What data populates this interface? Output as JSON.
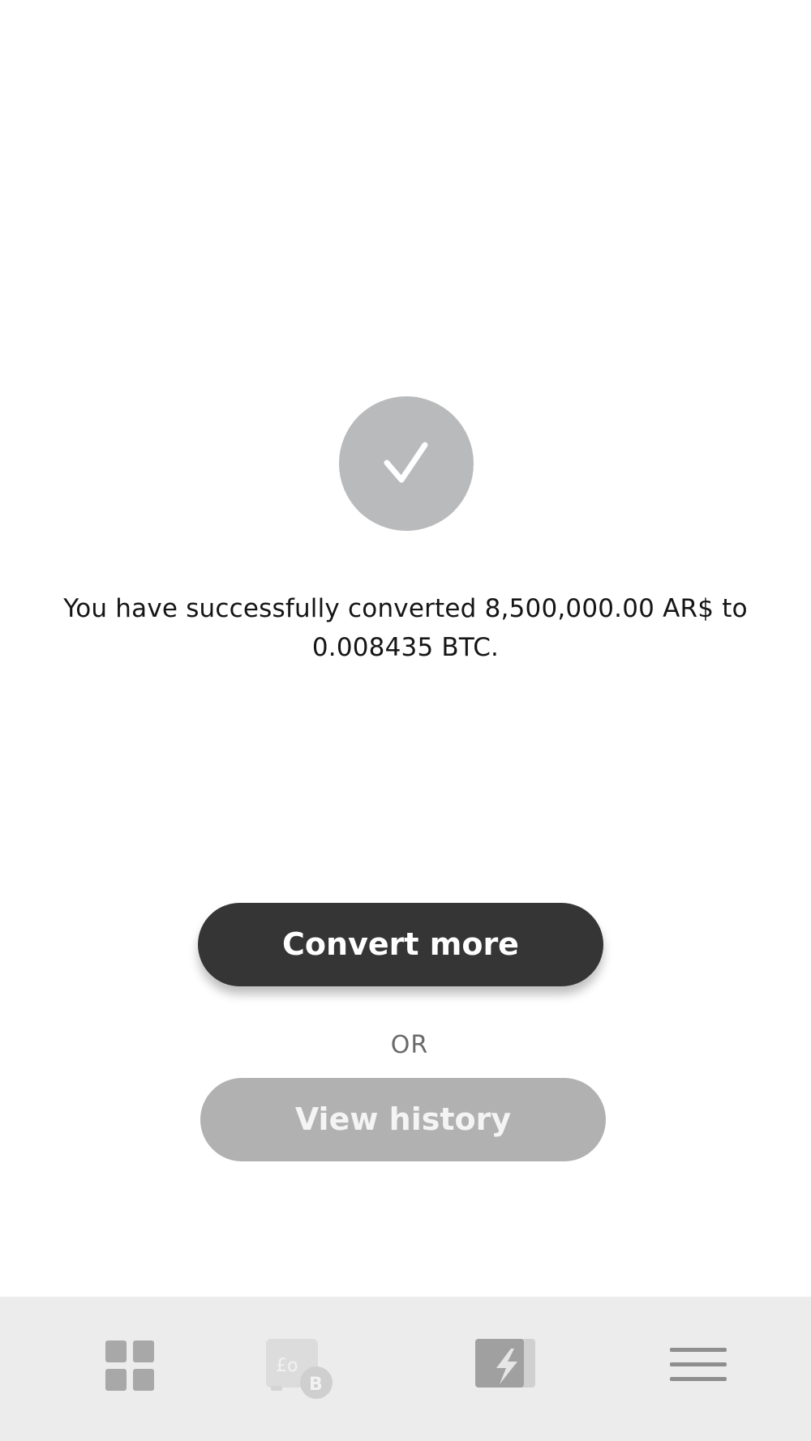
{
  "status": {
    "icon": "checkmark-icon",
    "message_line1": "You have successfully converted 8,500,000.00 AR$ to",
    "message_line2": "0.008435 BTC."
  },
  "actions": {
    "primary_label": "Convert more",
    "separator": "OR",
    "secondary_label": "View history"
  },
  "bottom_nav": {
    "items": [
      {
        "icon": "dashboard-grid-icon"
      },
      {
        "icon": "exchange-cash-bitcoin-icon"
      },
      {
        "icon": "lightning-convert-icon"
      },
      {
        "icon": "menu-hamburger-icon"
      }
    ]
  },
  "colors": {
    "primary_button": "#353535",
    "secondary_button": "#b1b1b1",
    "success_circle": "#b9babc",
    "nav_background": "#ececec"
  }
}
